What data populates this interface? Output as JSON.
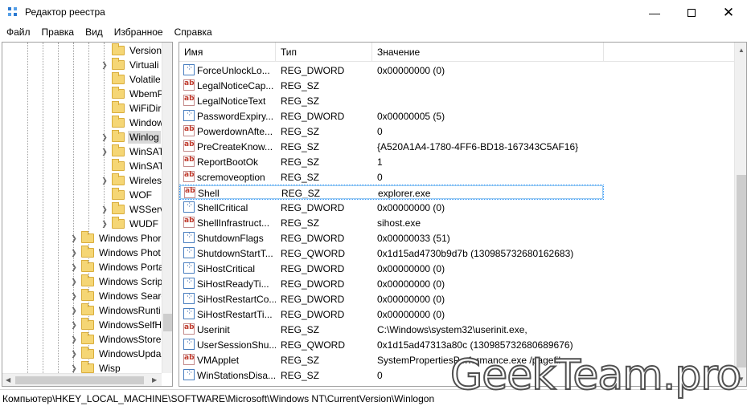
{
  "window": {
    "title": "Редактор реестра",
    "minimize_icon": "minimize-icon",
    "maximize_icon": "maximize-icon",
    "close_icon": "close-icon"
  },
  "menu": [
    "Файл",
    "Правка",
    "Вид",
    "Избранное",
    "Справка"
  ],
  "tree": {
    "nested_items": [
      {
        "label": "Version",
        "expandable": false
      },
      {
        "label": "Virtuali",
        "expandable": true
      },
      {
        "label": "Volatile",
        "expandable": false
      },
      {
        "label": "WbemP",
        "expandable": false
      },
      {
        "label": "WiFiDir",
        "expandable": false
      },
      {
        "label": "Window",
        "expandable": false
      },
      {
        "label": "Winlog",
        "expandable": true,
        "selected": true
      },
      {
        "label": "WinSAT",
        "expandable": true
      },
      {
        "label": "WinSAT",
        "expandable": false
      },
      {
        "label": "Wireles",
        "expandable": true
      },
      {
        "label": "WOF",
        "expandable": false
      },
      {
        "label": "WSServ",
        "expandable": true
      },
      {
        "label": "WUDF",
        "expandable": true
      }
    ],
    "root_items": [
      {
        "label": "Windows Phor"
      },
      {
        "label": "Windows Phot"
      },
      {
        "label": "Windows Porta"
      },
      {
        "label": "Windows Scrip"
      },
      {
        "label": "Windows Searc"
      },
      {
        "label": "WindowsRunti"
      },
      {
        "label": "WindowsSelfH"
      },
      {
        "label": "WindowsStore"
      },
      {
        "label": "WindowsUpda"
      },
      {
        "label": "Wisp"
      }
    ]
  },
  "columns": {
    "name": "Имя",
    "type": "Тип",
    "value": "Значение"
  },
  "rows": [
    {
      "icon": "binary-value-icon",
      "name": "ForceUnlockLo...",
      "type": "REG_DWORD",
      "value": "0x00000000 (0)"
    },
    {
      "icon": "string-value-icon",
      "name": "LegalNoticeCap...",
      "type": "REG_SZ",
      "value": ""
    },
    {
      "icon": "string-value-icon",
      "name": "LegalNoticeText",
      "type": "REG_SZ",
      "value": ""
    },
    {
      "icon": "binary-value-icon",
      "name": "PasswordExpiry...",
      "type": "REG_DWORD",
      "value": "0x00000005 (5)"
    },
    {
      "icon": "string-value-icon",
      "name": "PowerdownAfte...",
      "type": "REG_SZ",
      "value": "0"
    },
    {
      "icon": "string-value-icon",
      "name": "PreCreateKnow...",
      "type": "REG_SZ",
      "value": "{A520A1A4-1780-4FF6-BD18-167343C5AF16}"
    },
    {
      "icon": "string-value-icon",
      "name": "ReportBootOk",
      "type": "REG_SZ",
      "value": "1"
    },
    {
      "icon": "string-value-icon",
      "name": "scremoveoption",
      "type": "REG_SZ",
      "value": "0"
    },
    {
      "icon": "string-value-icon",
      "name": "Shell",
      "type": "REG_SZ",
      "value": "explorer.exe",
      "selected": true
    },
    {
      "icon": "binary-value-icon",
      "name": "ShellCritical",
      "type": "REG_DWORD",
      "value": "0x00000000 (0)"
    },
    {
      "icon": "string-value-icon",
      "name": "ShellInfrastruct...",
      "type": "REG_SZ",
      "value": "sihost.exe"
    },
    {
      "icon": "binary-value-icon",
      "name": "ShutdownFlags",
      "type": "REG_DWORD",
      "value": "0x00000033 (51)"
    },
    {
      "icon": "binary-value-icon",
      "name": "ShutdownStartT...",
      "type": "REG_QWORD",
      "value": "0x1d15ad4730b9d7b (130985732680162683)"
    },
    {
      "icon": "binary-value-icon",
      "name": "SiHostCritical",
      "type": "REG_DWORD",
      "value": "0x00000000 (0)"
    },
    {
      "icon": "binary-value-icon",
      "name": "SiHostReadyTi...",
      "type": "REG_DWORD",
      "value": "0x00000000 (0)"
    },
    {
      "icon": "binary-value-icon",
      "name": "SiHostRestartCo...",
      "type": "REG_DWORD",
      "value": "0x00000000 (0)"
    },
    {
      "icon": "binary-value-icon",
      "name": "SiHostRestartTi...",
      "type": "REG_DWORD",
      "value": "0x00000000 (0)"
    },
    {
      "icon": "string-value-icon",
      "name": "Userinit",
      "type": "REG_SZ",
      "value": "C:\\Windows\\system32\\userinit.exe,"
    },
    {
      "icon": "binary-value-icon",
      "name": "UserSessionShu...",
      "type": "REG_QWORD",
      "value": "0x1d15ad47313a80c (130985732680689676)"
    },
    {
      "icon": "string-value-icon",
      "name": "VMApplet",
      "type": "REG_SZ",
      "value": "SystemPropertiesPerformance.exe /pagefil"
    },
    {
      "icon": "binary-value-icon",
      "name": "WinStationsDisa...",
      "type": "REG_SZ",
      "value": "0"
    }
  ],
  "status": "Компьютер\\HKEY_LOCAL_MACHINE\\SOFTWARE\\Microsoft\\Windows NT\\CurrentVersion\\Winlogon",
  "watermark": "GeekTeam.pro"
}
